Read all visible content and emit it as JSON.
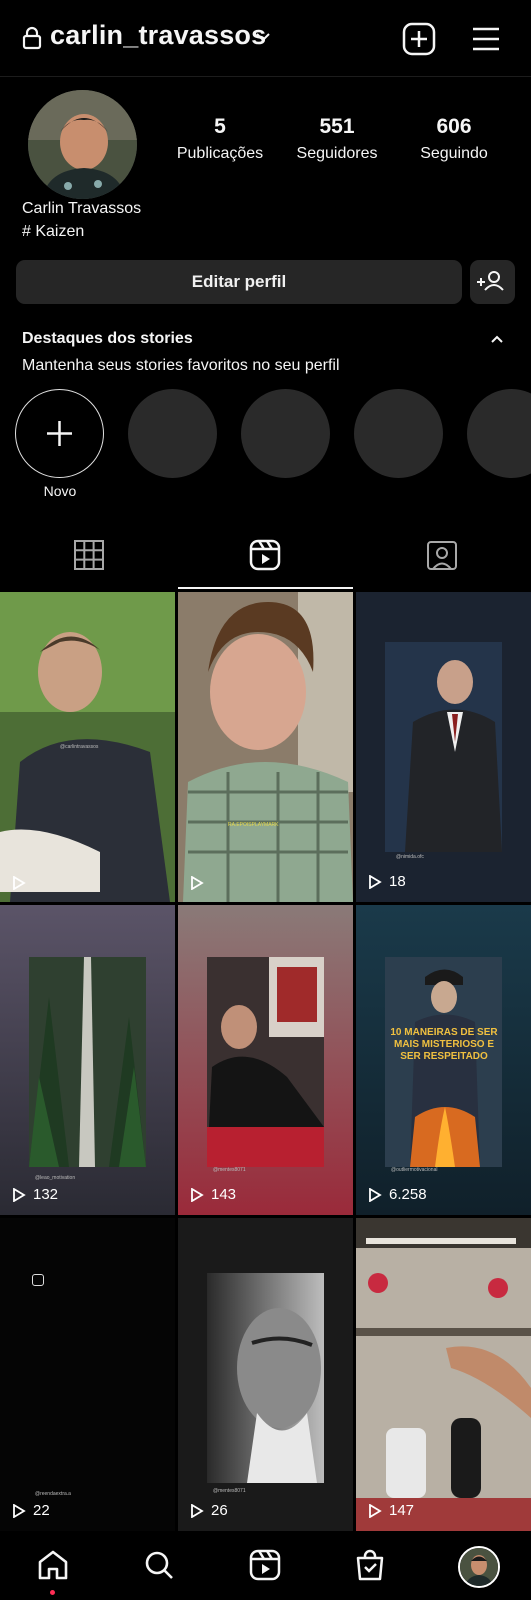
{
  "header": {
    "username": "carlin_travassos",
    "icons": [
      "lock-icon",
      "chevron-down-icon",
      "plus-square-icon",
      "hamburger-menu-icon"
    ]
  },
  "profile": {
    "stats": [
      {
        "value": "5",
        "label": "Publicações"
      },
      {
        "value": "551",
        "label": "Seguidores"
      },
      {
        "value": "606",
        "label": "Seguindo"
      }
    ],
    "display_name": "Carlin Travassos",
    "bio": "# Kaizen",
    "edit_button": "Editar perfil"
  },
  "highlights": {
    "title": "Destaques dos stories",
    "subtitle": "Mantenha seus stories favoritos no seu perfil",
    "new_label": "Novo"
  },
  "tabs": [
    {
      "name": "grid",
      "icon": "grid-icon"
    },
    {
      "name": "reels",
      "icon": "reels-icon",
      "active": true
    },
    {
      "name": "tagged",
      "icon": "tagged-person-icon"
    }
  ],
  "reels": [
    {
      "views": "",
      "caption": "@carlintravassos"
    },
    {
      "views": "",
      "caption": "RA.EPOISPLAYMARK"
    },
    {
      "views": "18",
      "caption": "@nimida.ofc"
    },
    {
      "views": "132",
      "caption": "@leao_motivation"
    },
    {
      "views": "143",
      "caption": "@mentes8071"
    },
    {
      "views": "6.258",
      "caption": "@outliermotivacional",
      "overlay_text": "10 MANEIRAS DE SER MAIS MISTERIOSO E SER RESPEITADO"
    },
    {
      "views": "22",
      "caption": "@reendaextra.a"
    },
    {
      "views": "26",
      "caption": "@mentes8071"
    },
    {
      "views": "147",
      "caption": ""
    }
  ],
  "colors": {
    "background": "#000000",
    "button": "#262626",
    "highlight_placeholder": "#2a2a2a",
    "notification_dot": "#ff2d55"
  },
  "bottom_nav": [
    "home-icon",
    "search-icon",
    "reels-icon",
    "shopping-bag-icon",
    "profile-avatar"
  ]
}
